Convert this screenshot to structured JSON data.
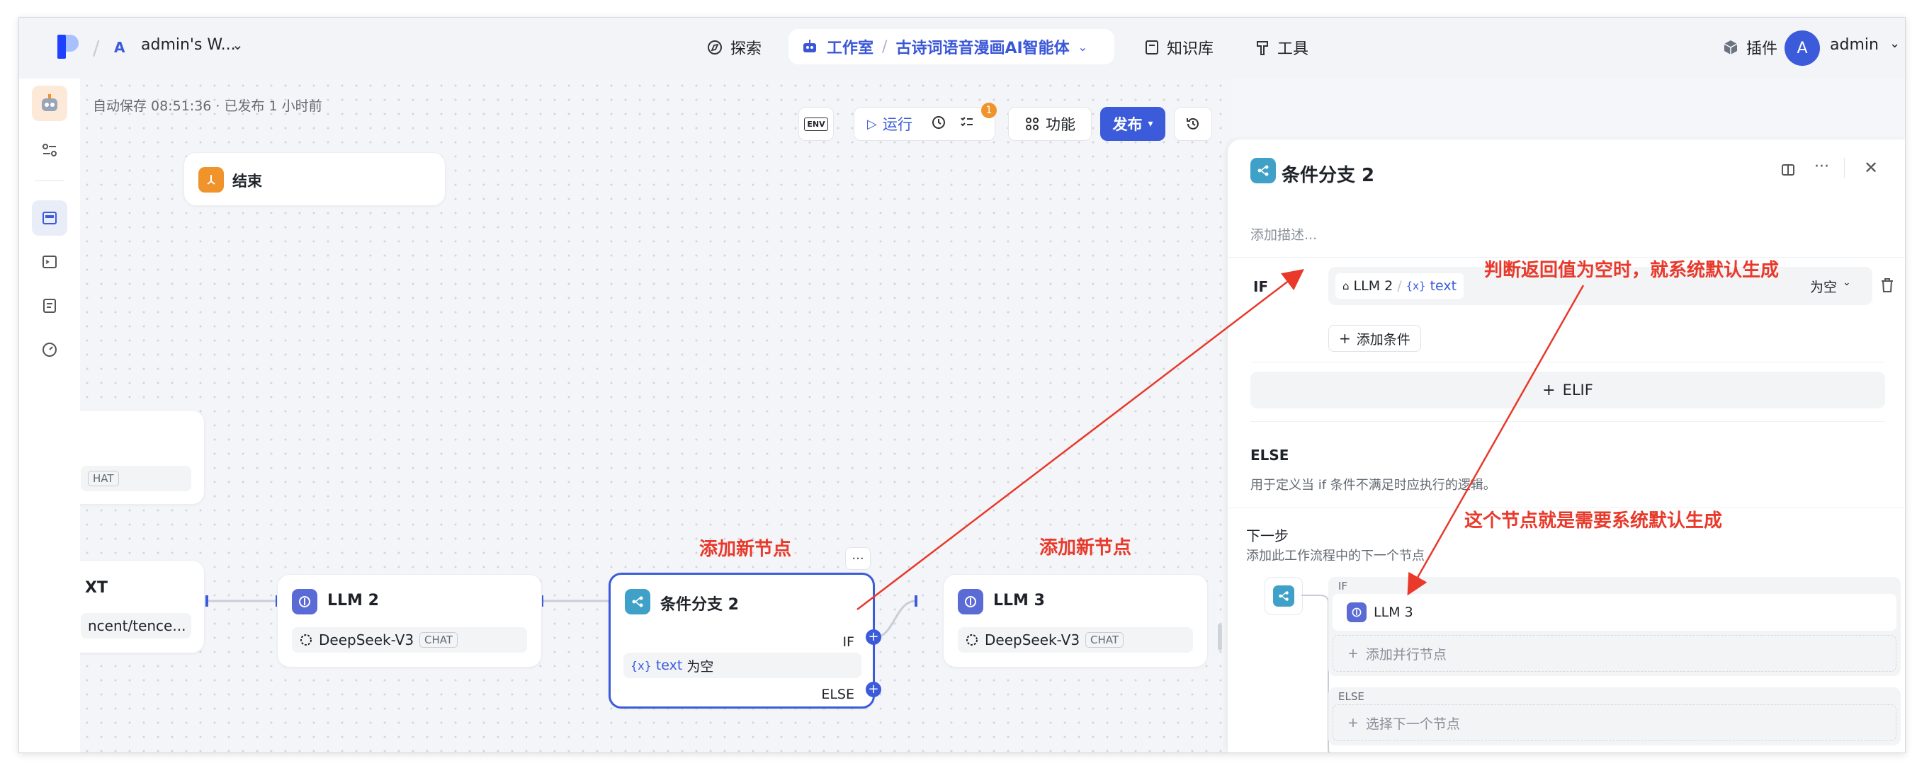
{
  "header": {
    "workspace_badge": "A",
    "workspace_name": "admin's W...",
    "nav": {
      "explore": "探索",
      "studio": "工作室",
      "app_name": "古诗词语音漫画AI智能体",
      "knowledge": "知识库",
      "tools": "工具",
      "plugins": "插件"
    },
    "user": {
      "avatar_letter": "A",
      "name": "admin"
    }
  },
  "canvas": {
    "autosave": "自动保存 08:51:36 · 已发布 1 小时前",
    "toolbar": {
      "env": "ENV",
      "run": "运行",
      "badge_count": "1",
      "features": "功能",
      "publish": "发布"
    },
    "nodes": {
      "end": {
        "title": "结束"
      },
      "partial_top": {
        "tag": "HAT"
      },
      "partial_left": {
        "title": "XT",
        "detail": "ncent/tence..."
      },
      "llm2": {
        "title": "LLM 2",
        "model": "DeepSeek-V3",
        "tag": "CHAT"
      },
      "cond": {
        "title": "条件分支 2",
        "if_label": "IF",
        "else_label": "ELSE",
        "var_icon": "{x}",
        "var_name": "text",
        "op": "为空",
        "more": "···"
      },
      "llm3": {
        "title": "LLM 3",
        "model": "DeepSeek-V3",
        "tag": "CHAT"
      }
    },
    "annotations": {
      "add_node_1": "添加新节点",
      "add_node_2": "添加新节点",
      "empty_default": "判断返回值为空时，就系统默认生成",
      "default_node": "这个节点就是需要系统默认生成"
    }
  },
  "panel": {
    "title": "条件分支 2",
    "desc_placeholder": "添加描述...",
    "if_label": "IF",
    "condition": {
      "source": "LLM 2",
      "var_icon": "{x}",
      "var": "text",
      "operator": "为空"
    },
    "add_condition": "添加条件",
    "elif": "ELIF",
    "else_title": "ELSE",
    "else_desc": "用于定义当 if 条件不满足时应执行的逻辑。",
    "next_step_title": "下一步",
    "next_step_desc": "添加此工作流程中的下一个节点",
    "branches": {
      "if_label": "IF",
      "if_node": "LLM 3",
      "add_parallel": "添加并行节点",
      "else_label": "ELSE",
      "select_next": "选择下一个节点"
    }
  },
  "colors": {
    "primary": "#3b5bdb",
    "annotation": "#e8392b",
    "cond_icon": "#3fa0c8",
    "llm_icon": "#5b6bd6",
    "end_icon": "#f0932b"
  }
}
